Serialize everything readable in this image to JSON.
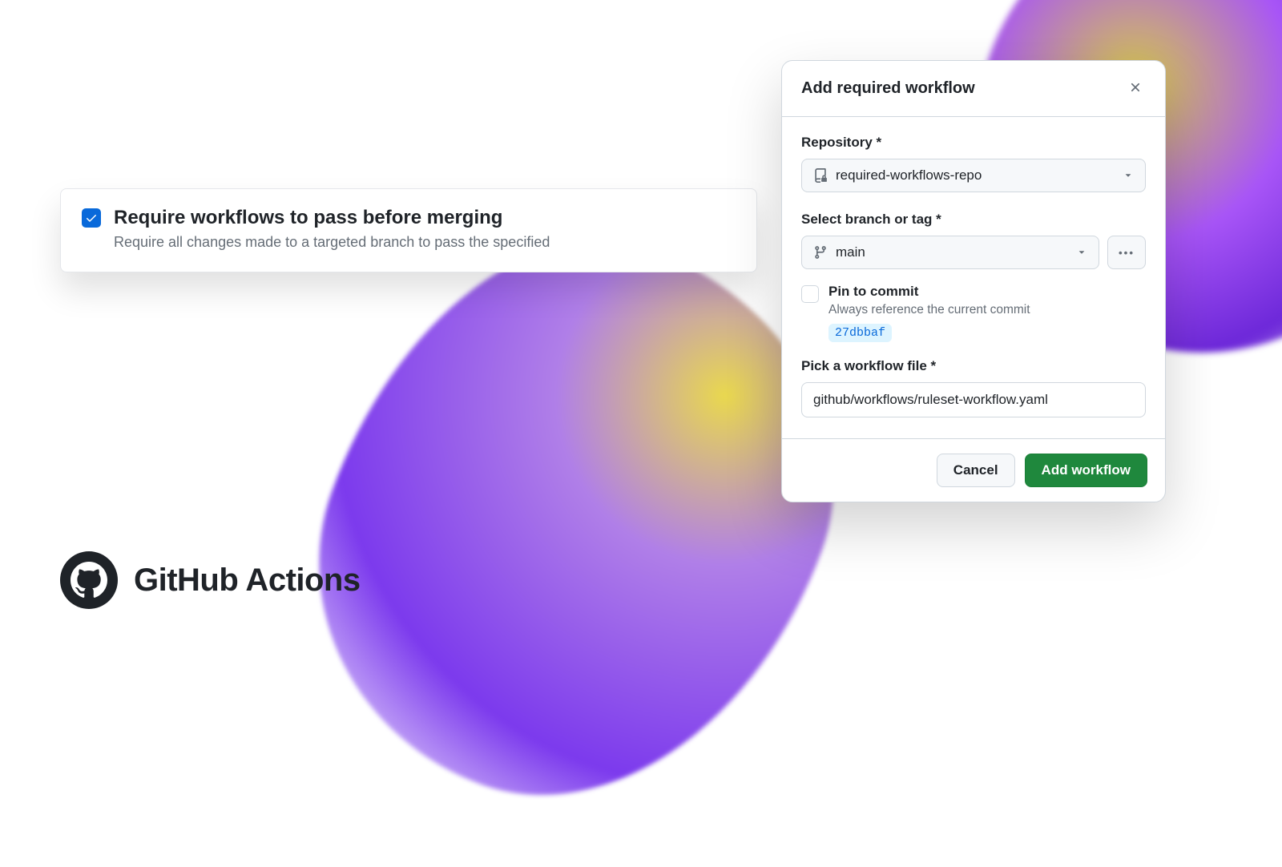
{
  "requireCard": {
    "title": "Require workflows to pass before merging",
    "description": "Require all changes made to a targeted branch to pass the specified"
  },
  "modal": {
    "title": "Add required workflow",
    "repositoryLabel": "Repository *",
    "repositoryValue": "required-workflows-repo",
    "branchLabel": "Select branch or tag *",
    "branchValue": "main",
    "moreLabel": "•••",
    "pinTitle": "Pin to commit",
    "pinDescription": "Always reference the current commit",
    "commitSha": "27dbbaf",
    "workflowLabel": "Pick a workflow file *",
    "workflowValue": "github/workflows/ruleset-workflow.yaml",
    "cancelLabel": "Cancel",
    "submitLabel": "Add workflow"
  },
  "brand": {
    "text": "GitHub Actions"
  }
}
